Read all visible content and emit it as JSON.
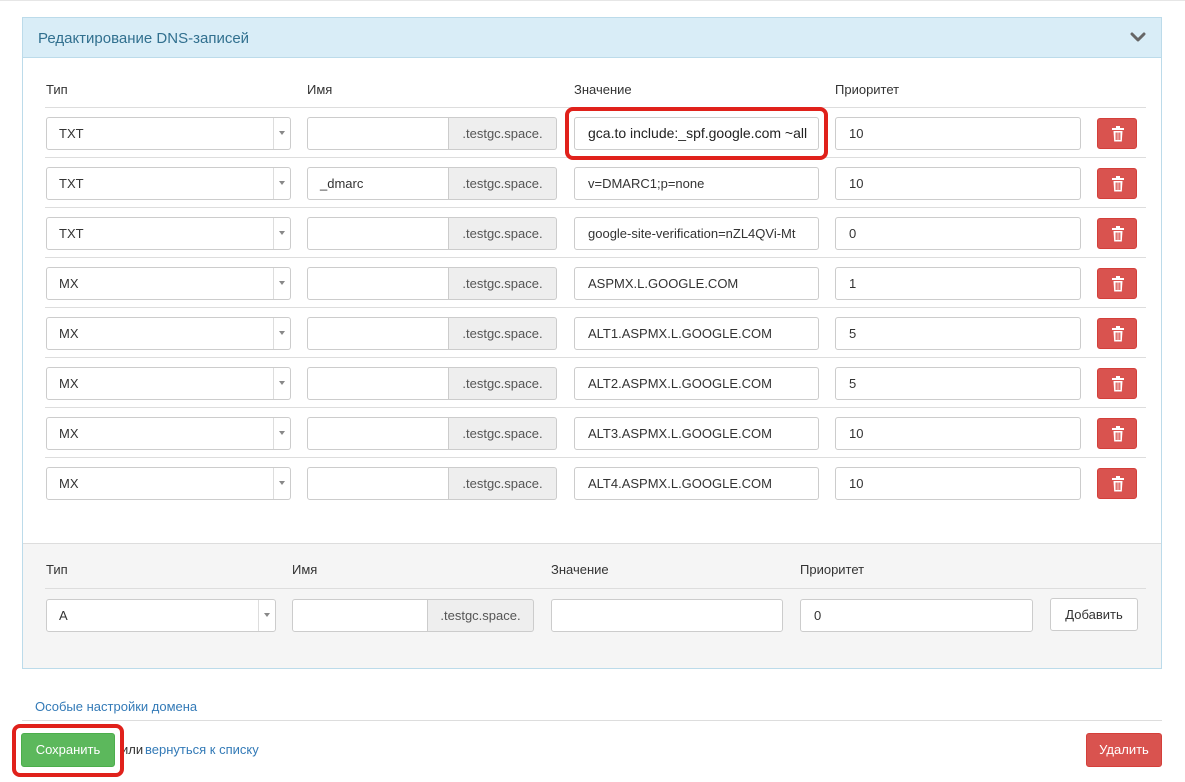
{
  "panel": {
    "title": "Редактирование DNS-записей"
  },
  "columns": {
    "type": "Тип",
    "name": "Имя",
    "value": "Значение",
    "priority": "Приоритет"
  },
  "domain_suffix": ".testgc.space.",
  "records": [
    {
      "type": "TXT",
      "name": "",
      "value": "gca.to include:_spf.google.com ~all",
      "priority": "10"
    },
    {
      "type": "TXT",
      "name": "_dmarc",
      "value": "v=DMARC1;p=none",
      "priority": "10"
    },
    {
      "type": "TXT",
      "name": "",
      "value": "google-site-verification=nZL4QVi-Mt",
      "priority": "0"
    },
    {
      "type": "MX",
      "name": "",
      "value": "ASPMX.L.GOOGLE.COM",
      "priority": "1"
    },
    {
      "type": "MX",
      "name": "",
      "value": "ALT1.ASPMX.L.GOOGLE.COM",
      "priority": "5"
    },
    {
      "type": "MX",
      "name": "",
      "value": "ALT2.ASPMX.L.GOOGLE.COM",
      "priority": "5"
    },
    {
      "type": "MX",
      "name": "",
      "value": "ALT3.ASPMX.L.GOOGLE.COM",
      "priority": "10"
    },
    {
      "type": "MX",
      "name": "",
      "value": "ALT4.ASPMX.L.GOOGLE.COM",
      "priority": "10"
    }
  ],
  "new_record": {
    "type": "A",
    "name": "",
    "value": "",
    "priority": "0",
    "add_label": "Добавить"
  },
  "links": {
    "special_settings": "Особые настройки домена",
    "back_prefix": "или",
    "back_to_list": "вернуться к списку"
  },
  "actions": {
    "save": "Сохранить",
    "delete": "Удалить"
  },
  "colors": {
    "heading_bg": "#d9edf7",
    "heading_text": "#31708f",
    "success": "#5cb85c",
    "danger": "#d9534f",
    "highlight": "#e0211b",
    "link": "#337ab7"
  },
  "icons": {
    "collapse": "chevron-down-icon",
    "delete": "trash-icon"
  }
}
